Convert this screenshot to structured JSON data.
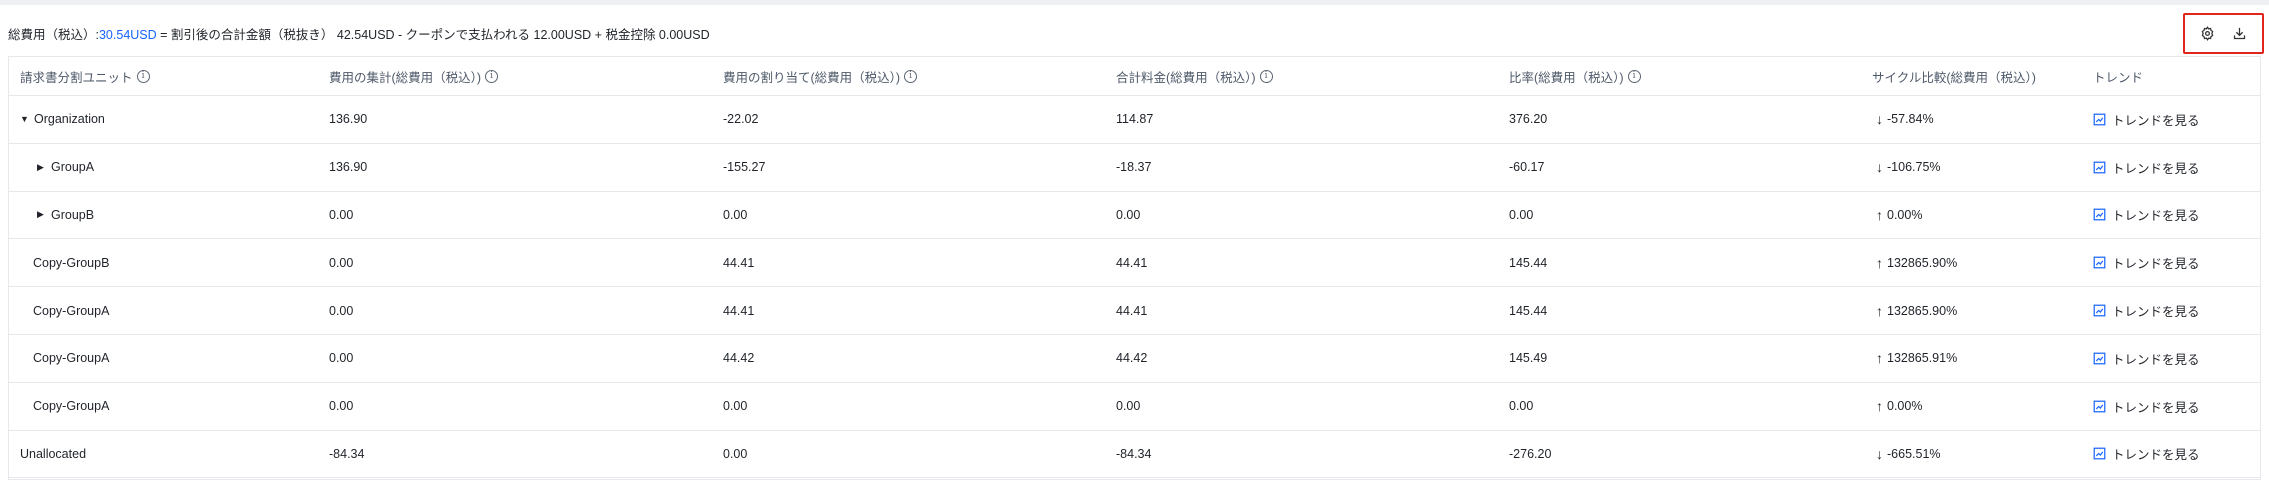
{
  "summary": {
    "prefix": "総費用（税込）:",
    "total": "30.54USD",
    "formula": " = 割引後の合計金額（税抜き） 42.54USD - クーポンで支払われる 12.00USD + 税金控除 0.00USD"
  },
  "toolbar": {
    "settings_icon": "gear-icon",
    "download_icon": "download-icon"
  },
  "columns": [
    {
      "label": "請求書分割ユニット",
      "info": true
    },
    {
      "label": "費用の集計(総費用（税込）)",
      "info": true
    },
    {
      "label": "費用の割り当て(総費用（税込）)",
      "info": true
    },
    {
      "label": "合計料金(総費用（税込）)",
      "info": true
    },
    {
      "label": "比率(総費用（税込）)",
      "info": true
    },
    {
      "label": "サイクル比較(総費用（税込）)",
      "info": false
    },
    {
      "label": "トレンド",
      "info": false
    }
  ],
  "rows": [
    {
      "name": "Organization",
      "indent": 0,
      "caret": "down",
      "agg": "136.90",
      "alloc": "-22.02",
      "total": "114.87",
      "ratio": "376.20",
      "cycle": "-57.84%",
      "dir": "down",
      "trend": "トレンドを見る"
    },
    {
      "name": "GroupA",
      "indent": 1,
      "caret": "right",
      "agg": "136.90",
      "alloc": "-155.27",
      "total": "-18.37",
      "ratio": "-60.17",
      "cycle": "-106.75%",
      "dir": "down",
      "trend": "トレンドを見る"
    },
    {
      "name": "GroupB",
      "indent": 1,
      "caret": "right",
      "agg": "0.00",
      "alloc": "0.00",
      "total": "0.00",
      "ratio": "0.00",
      "cycle": "0.00%",
      "dir": "up",
      "trend": "トレンドを見る"
    },
    {
      "name": "Copy-GroupB",
      "indent": 2,
      "caret": "",
      "agg": "0.00",
      "alloc": "44.41",
      "total": "44.41",
      "ratio": "145.44",
      "cycle": "132865.90%",
      "dir": "up",
      "trend": "トレンドを見る"
    },
    {
      "name": "Copy-GroupA",
      "indent": 2,
      "caret": "",
      "agg": "0.00",
      "alloc": "44.41",
      "total": "44.41",
      "ratio": "145.44",
      "cycle": "132865.90%",
      "dir": "up",
      "trend": "トレンドを見る"
    },
    {
      "name": "Copy-GroupA",
      "indent": 2,
      "caret": "",
      "agg": "0.00",
      "alloc": "44.42",
      "total": "44.42",
      "ratio": "145.49",
      "cycle": "132865.91%",
      "dir": "up",
      "trend": "トレンドを見る"
    },
    {
      "name": "Copy-GroupA",
      "indent": 2,
      "caret": "",
      "agg": "0.00",
      "alloc": "0.00",
      "total": "0.00",
      "ratio": "0.00",
      "cycle": "0.00%",
      "dir": "up",
      "trend": "トレンドを見る"
    },
    {
      "name": "Unallocated",
      "indent": 0,
      "caret": "",
      "agg": "-84.34",
      "alloc": "0.00",
      "total": "-84.34",
      "ratio": "-276.20",
      "cycle": "-665.51%",
      "dir": "down",
      "trend": "トレンドを見る"
    }
  ],
  "colors": {
    "accent": "#1664ff",
    "decrease": "#2ba471",
    "increase": "#f23030",
    "highlight_border": "#e1251b"
  }
}
